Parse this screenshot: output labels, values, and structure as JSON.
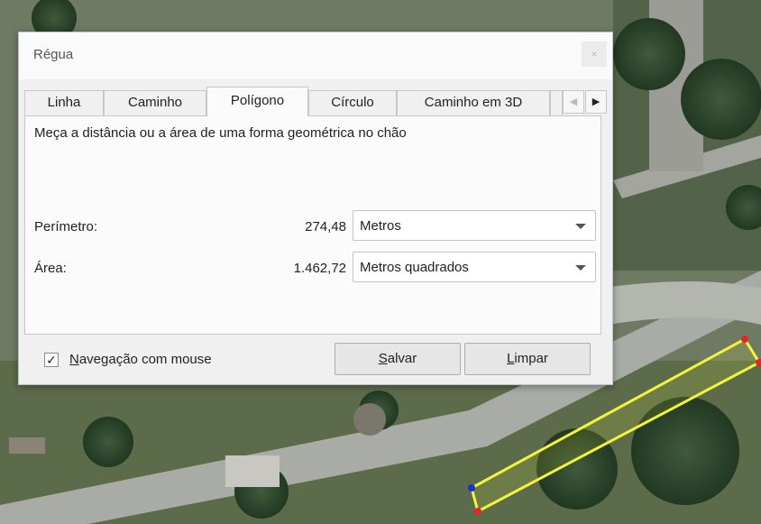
{
  "dialog": {
    "title": "Régua",
    "close_label": "×"
  },
  "tabs": [
    {
      "label": "Linha"
    },
    {
      "label": "Caminho"
    },
    {
      "label": "Polígono",
      "active": true
    },
    {
      "label": "Círculo"
    },
    {
      "label": "Caminho em 3D"
    }
  ],
  "tab_scroll": {
    "left": "◀",
    "right": "▶"
  },
  "panel": {
    "description": "Meça a distância ou a área de uma forma geométrica no chão",
    "perimeter": {
      "label": "Perímetro:",
      "value": "274,48",
      "unit": "Metros"
    },
    "area": {
      "label": "Área:",
      "value": "1.462,72",
      "unit": "Metros quadrados"
    }
  },
  "footer": {
    "mouse_nav": {
      "checked": true,
      "check_mark": "✓",
      "label_first": "N",
      "label_rest": "avegação com mouse"
    },
    "save": {
      "first": "S",
      "rest": "alvar"
    },
    "clear": {
      "first": "L",
      "rest": "impar"
    }
  },
  "colors": {
    "polygon_line": "#f4f43a",
    "vertex": "#e8232a",
    "vertex_active": "#1a2fd6"
  }
}
